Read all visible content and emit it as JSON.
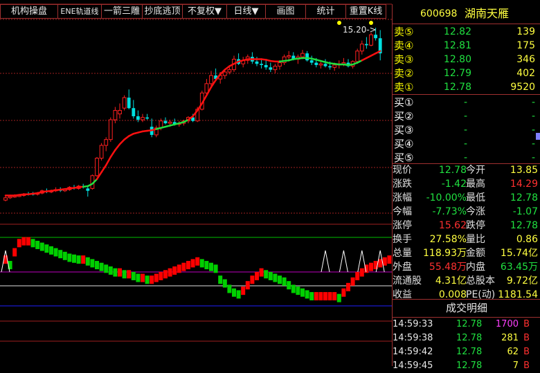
{
  "toolbar": {
    "buttons": [
      "机构操盘",
      "ENE轨道线",
      "一箭三雕",
      "抄底逃顶",
      "不复权▼",
      "日线▼",
      "画图",
      "统计",
      "重置K线"
    ]
  },
  "chart": {
    "price_annotation": "15.20->",
    "candles": [
      [
        3.6,
        4.0,
        3.5,
        3.8,
        "u"
      ],
      [
        3.8,
        4.0,
        3.7,
        3.9,
        "u"
      ],
      [
        3.9,
        4.1,
        3.8,
        3.95,
        "u"
      ],
      [
        3.95,
        4.1,
        3.85,
        4.0,
        "u"
      ],
      [
        4.0,
        4.2,
        3.9,
        4.1,
        "u"
      ],
      [
        4.1,
        4.3,
        4.0,
        4.15,
        "d"
      ],
      [
        4.15,
        4.3,
        4.0,
        4.1,
        "d"
      ],
      [
        4.1,
        4.3,
        4.0,
        4.2,
        "u"
      ],
      [
        4.2,
        4.5,
        4.1,
        4.4,
        "u"
      ],
      [
        4.4,
        4.6,
        4.2,
        4.3,
        "d"
      ],
      [
        4.3,
        4.5,
        4.2,
        4.4,
        "u"
      ],
      [
        4.4,
        4.7,
        4.3,
        4.5,
        "u"
      ],
      [
        4.5,
        4.7,
        4.3,
        4.4,
        "d"
      ],
      [
        4.4,
        4.6,
        4.3,
        4.5,
        "u"
      ],
      [
        4.5,
        4.8,
        4.4,
        4.7,
        "u"
      ],
      [
        4.7,
        4.9,
        4.5,
        4.6,
        "d"
      ],
      [
        4.6,
        4.9,
        4.5,
        4.8,
        "u"
      ],
      [
        4.8,
        5.0,
        4.6,
        4.7,
        "d"
      ],
      [
        4.4,
        4.8,
        3.9,
        4.6,
        "c"
      ],
      [
        4.6,
        5.8,
        4.5,
        5.7,
        "u"
      ],
      [
        5.7,
        7.3,
        5.6,
        7.2,
        "u"
      ],
      [
        7.2,
        8.5,
        7.0,
        8.3,
        "u"
      ],
      [
        8.3,
        9.0,
        7.8,
        8.8,
        "u"
      ],
      [
        8.8,
        10.7,
        8.6,
        10.5,
        "u"
      ],
      [
        10.5,
        11.6,
        10.2,
        11.3,
        "u"
      ],
      [
        11.3,
        11.9,
        10.6,
        11.0,
        "u"
      ],
      [
        11.5,
        12.6,
        11.3,
        12.4,
        "u"
      ],
      [
        12.4,
        13.1,
        11.4,
        11.5,
        "d"
      ],
      [
        11.5,
        12.2,
        10.6,
        10.8,
        "d"
      ],
      [
        10.8,
        11.3,
        10.3,
        10.5,
        "d"
      ],
      [
        10.5,
        11.0,
        10.3,
        10.7,
        "u"
      ],
      [
        10.7,
        11.0,
        10.5,
        10.6,
        "d"
      ],
      [
        9.9,
        10.6,
        9.0,
        9.2,
        "d"
      ],
      [
        9.2,
        10.0,
        9.0,
        9.8,
        "u"
      ],
      [
        9.8,
        10.6,
        9.6,
        10.4,
        "u"
      ],
      [
        10.4,
        10.7,
        10.1,
        10.2,
        "d"
      ],
      [
        10.2,
        10.5,
        9.9,
        10.3,
        "u"
      ],
      [
        10.3,
        10.6,
        10.0,
        10.1,
        "d"
      ],
      [
        10.1,
        10.4,
        9.9,
        10.2,
        "u"
      ],
      [
        10.2,
        10.5,
        10.0,
        10.4,
        "u"
      ],
      [
        10.4,
        10.8,
        10.2,
        10.7,
        "u"
      ],
      [
        10.7,
        11.0,
        10.3,
        10.4,
        "d"
      ],
      [
        10.4,
        11.6,
        10.3,
        11.4,
        "u"
      ],
      [
        11.4,
        13.0,
        11.3,
        12.8,
        "u"
      ],
      [
        12.8,
        14.0,
        12.5,
        13.6,
        "u"
      ],
      [
        13.6,
        14.7,
        13.3,
        14.3,
        "u"
      ],
      [
        14.3,
        14.9,
        13.8,
        14.0,
        "d"
      ],
      [
        14.0,
        14.6,
        13.6,
        14.3,
        "u"
      ],
      [
        14.3,
        14.8,
        14.0,
        14.6,
        "u"
      ],
      [
        14.6,
        15.0,
        14.4,
        14.8,
        "u"
      ],
      [
        14.8,
        16.0,
        14.6,
        15.7,
        "u"
      ],
      [
        15.7,
        16.2,
        15.2,
        15.3,
        "d"
      ],
      [
        15.3,
        15.9,
        15.0,
        15.6,
        "u"
      ],
      [
        15.6,
        16.1,
        15.3,
        15.9,
        "u"
      ],
      [
        15.9,
        16.3,
        15.3,
        15.5,
        "d"
      ],
      [
        15.5,
        15.9,
        15.1,
        15.3,
        "d"
      ],
      [
        15.3,
        15.7,
        14.9,
        15.2,
        "d"
      ],
      [
        15.2,
        15.6,
        14.8,
        15.0,
        "d"
      ],
      [
        15.0,
        15.4,
        14.6,
        14.8,
        "d"
      ],
      [
        14.8,
        15.3,
        14.5,
        15.1,
        "u"
      ],
      [
        15.1,
        15.6,
        14.8,
        15.4,
        "u"
      ],
      [
        15.4,
        16.1,
        15.2,
        15.9,
        "u"
      ],
      [
        15.9,
        16.4,
        15.5,
        16.0,
        "u"
      ],
      [
        16.0,
        16.3,
        15.6,
        15.7,
        "d"
      ],
      [
        15.7,
        16.1,
        15.3,
        15.9,
        "u"
      ],
      [
        15.9,
        16.5,
        15.7,
        16.2,
        "u"
      ],
      [
        16.2,
        16.4,
        15.5,
        15.6,
        "d"
      ],
      [
        15.6,
        16.0,
        15.2,
        15.4,
        "d"
      ],
      [
        15.4,
        15.8,
        15.0,
        15.2,
        "d"
      ],
      [
        15.2,
        15.6,
        14.9,
        15.3,
        "u"
      ],
      [
        15.3,
        15.7,
        15.0,
        15.1,
        "d"
      ],
      [
        15.1,
        15.5,
        14.8,
        15.0,
        "d"
      ],
      [
        15.0,
        15.4,
        14.7,
        15.2,
        "u"
      ],
      [
        15.2,
        15.6,
        14.9,
        15.3,
        "u"
      ],
      [
        15.3,
        15.8,
        15.1,
        15.4,
        "u"
      ],
      [
        15.4,
        15.7,
        15.0,
        15.1,
        "d"
      ],
      [
        15.1,
        15.6,
        14.9,
        15.5,
        "u"
      ],
      [
        15.5,
        16.6,
        15.3,
        16.4,
        "u"
      ],
      [
        16.4,
        17.3,
        16.1,
        17.0,
        "u"
      ],
      [
        17.0,
        17.6,
        16.6,
        16.9,
        "d"
      ],
      [
        16.9,
        18.0,
        16.8,
        17.8,
        "u"
      ],
      [
        17.8,
        18.4,
        17.3,
        17.5,
        "d"
      ],
      [
        17.5,
        18.2,
        15.6,
        16.2,
        "d"
      ]
    ],
    "ma_line": [
      4.0,
      4.0,
      4.0,
      4.05,
      4.1,
      4.1,
      4.15,
      4.2,
      4.3,
      4.35,
      4.4,
      4.45,
      4.5,
      4.55,
      4.6,
      4.65,
      4.7,
      4.75,
      4.8,
      5.0,
      5.4,
      6.0,
      6.6,
      7.3,
      7.9,
      8.4,
      8.8,
      9.1,
      9.3,
      9.4,
      9.5,
      9.55,
      9.6,
      9.7,
      9.8,
      9.9,
      10.0,
      10.1,
      10.2,
      10.3,
      10.5,
      10.8,
      11.3,
      11.9,
      12.6,
      13.3,
      13.9,
      14.4,
      14.8,
      15.1,
      15.3,
      15.5,
      15.6,
      15.7,
      15.7,
      15.7,
      15.7,
      15.65,
      15.55,
      15.5,
      15.5,
      15.55,
      15.6,
      15.7,
      15.75,
      15.8,
      15.8,
      15.75,
      15.65,
      15.55,
      15.45,
      15.35,
      15.3,
      15.25,
      15.25,
      15.2,
      15.25,
      15.4,
      15.6,
      15.8,
      16.0,
      16.2,
      16.4
    ],
    "ma_green_ranges": [
      [
        17,
        19
      ],
      [
        33,
        39
      ],
      [
        60,
        77
      ]
    ],
    "osc": [
      -1,
      -4,
      3,
      8,
      9,
      9,
      8,
      7,
      6,
      5,
      4,
      3,
      2,
      1,
      0,
      -0.5,
      -1,
      -1,
      -2,
      -3,
      -4,
      -5,
      -6,
      -7,
      -8,
      -8,
      -9,
      -9,
      -10,
      -11,
      -11,
      -12,
      -12,
      -11,
      -10,
      -9,
      -8,
      -7,
      -6,
      -5,
      -4,
      -3,
      -2,
      -3,
      -4,
      -5,
      -6,
      -12,
      -14,
      -17,
      -19,
      -20,
      -18,
      -15,
      -12,
      -10,
      -8,
      -9,
      -10,
      -11,
      -12,
      -13,
      -15,
      -17,
      -18,
      -19,
      -20,
      -21,
      -21,
      -21,
      -21,
      -21,
      -21,
      -22,
      -19,
      -16,
      -13,
      -10,
      -8,
      -6,
      -5,
      -4,
      -3,
      -2,
      -1
    ],
    "osc_peaks": [
      0,
      70,
      74,
      78,
      82
    ]
  },
  "quote": {
    "code": "600698",
    "name": "湖南天雁",
    "sells": [
      {
        "label": "卖⑤",
        "price": "12.82",
        "vol": "139"
      },
      {
        "label": "卖④",
        "price": "12.81",
        "vol": "175"
      },
      {
        "label": "卖③",
        "price": "12.80",
        "vol": "346"
      },
      {
        "label": "卖②",
        "price": "12.79",
        "vol": "402"
      },
      {
        "label": "卖①",
        "price": "12.78",
        "vol": "9520"
      }
    ],
    "buys": [
      {
        "label": "买①",
        "price": "-",
        "vol": "-"
      },
      {
        "label": "买②",
        "price": "-",
        "vol": "-"
      },
      {
        "label": "买③",
        "price": "-",
        "vol": "-"
      },
      {
        "label": "买④",
        "price": "-",
        "vol": "-"
      },
      {
        "label": "买⑤",
        "price": "-",
        "vol": "-"
      }
    ],
    "stats": [
      {
        "l1": "现价",
        "v1": "12.78",
        "c1": "green",
        "l2": "今开",
        "v2": "13.85",
        "c2": "yellow"
      },
      {
        "l1": "涨跌",
        "v1": "-1.42",
        "c1": "green",
        "l2": "最高",
        "v2": "14.29",
        "c2": "red"
      },
      {
        "l1": "涨幅",
        "v1": "-10.00%",
        "c1": "green",
        "l2": "最低",
        "v2": "12.78",
        "c2": "green"
      },
      {
        "l1": "今幅",
        "v1": "-7.73%",
        "c1": "green",
        "l2": "今涨",
        "v2": "-1.07",
        "c2": "green"
      },
      {
        "l1": "涨停",
        "v1": "15.62",
        "c1": "red",
        "l2": "跌停",
        "v2": "12.78",
        "c2": "green"
      },
      {
        "l1": "换手",
        "v1": "27.58%",
        "c1": "yellow",
        "l2": "量比",
        "v2": "0.86",
        "c2": "yellow"
      },
      {
        "l1": "总量",
        "v1": "118.93万",
        "c1": "yellow",
        "l2": "金额",
        "v2": "15.74亿",
        "c2": "yellow"
      },
      {
        "l1": "外盘",
        "v1": "55.48万",
        "c1": "red",
        "l2": "内盘",
        "v2": "63.45万",
        "c2": "green"
      },
      {
        "l1": "流通股",
        "v1": "4.31亿",
        "c1": "yellow",
        "l2": "总股本",
        "v2": "9.72亿",
        "c2": "yellow"
      },
      {
        "l1": "收益",
        "v1": "0.008",
        "c1": "yellow",
        "l2": "PE(动)",
        "v2": "1181.54",
        "c2": "yellow"
      }
    ],
    "detail_title": "成交明细",
    "ticks": [
      {
        "time": "14:59:33",
        "price": "12.78",
        "vol": "1700",
        "dir": "B",
        "vc": "magenta"
      },
      {
        "time": "14:59:38",
        "price": "12.78",
        "vol": "281",
        "dir": "B",
        "vc": "yellow"
      },
      {
        "time": "14:59:42",
        "price": "12.78",
        "vol": "62",
        "dir": "B",
        "vc": "yellow"
      },
      {
        "time": "14:59:45",
        "price": "12.78",
        "vol": "7",
        "dir": "B",
        "vc": "yellow"
      }
    ]
  },
  "colors": {
    "up": "#ff2020",
    "down": "#00e0e0",
    "ma_red": "#ff1010",
    "ma_green": "#20e040",
    "grid": "#a02020",
    "osc_up": "#ff0000",
    "osc_down": "#00d000"
  }
}
